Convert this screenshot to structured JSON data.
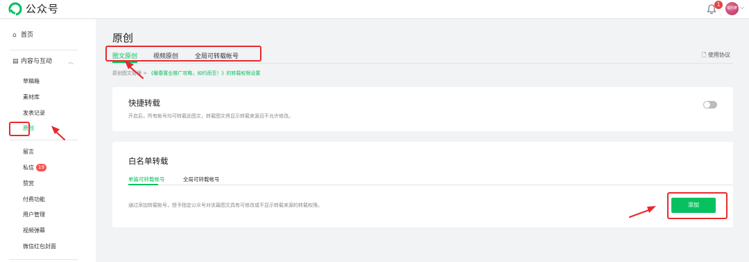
{
  "app": {
    "brand": "公众号",
    "notification_count": "1",
    "avatar_text": "福尔摩斯"
  },
  "sidebar": {
    "home": "首页",
    "content_group": "内容与互动",
    "items": [
      {
        "label": "草稿箱"
      },
      {
        "label": "素材库"
      },
      {
        "label": "发表记录"
      },
      {
        "label": "原创",
        "active": true
      },
      {
        "label": "留言"
      },
      {
        "label": "私信",
        "badge": "19"
      },
      {
        "label": "赞赏"
      },
      {
        "label": "付费功能"
      },
      {
        "label": "用户管理"
      },
      {
        "label": "视频弹幕"
      },
      {
        "label": "微信红包封面"
      }
    ]
  },
  "main": {
    "title": "原创",
    "tabs": [
      {
        "label": "图文原创",
        "active": true
      },
      {
        "label": "视频原创"
      },
      {
        "label": "全局可转载帐号"
      }
    ],
    "agreement": "使用协议",
    "breadcrumb": {
      "root": "原创图文管理",
      "sep": ">",
      "current": "《暖春置业推广攻略，如约而至！》的转载权限设置"
    }
  },
  "quick_repost": {
    "title": "快捷转载",
    "desc": "开启后，所有帐号均可转载此图文，转载图文将显示转载来源且不允许修改。",
    "enabled": false
  },
  "whitelist": {
    "title": "白名单转载",
    "tabs": [
      {
        "label": "单篇可转载帐号",
        "active": true
      },
      {
        "label": "全局可转载帐号"
      }
    ],
    "desc": "通过添加转载帐号，授予指定公众号对该篇图文具有可修改或不显示转载来源的转载权限。",
    "add_button": "添加"
  },
  "colors": {
    "accent": "#07c160",
    "annotation": "#e8282b",
    "badge": "#fa5151"
  }
}
